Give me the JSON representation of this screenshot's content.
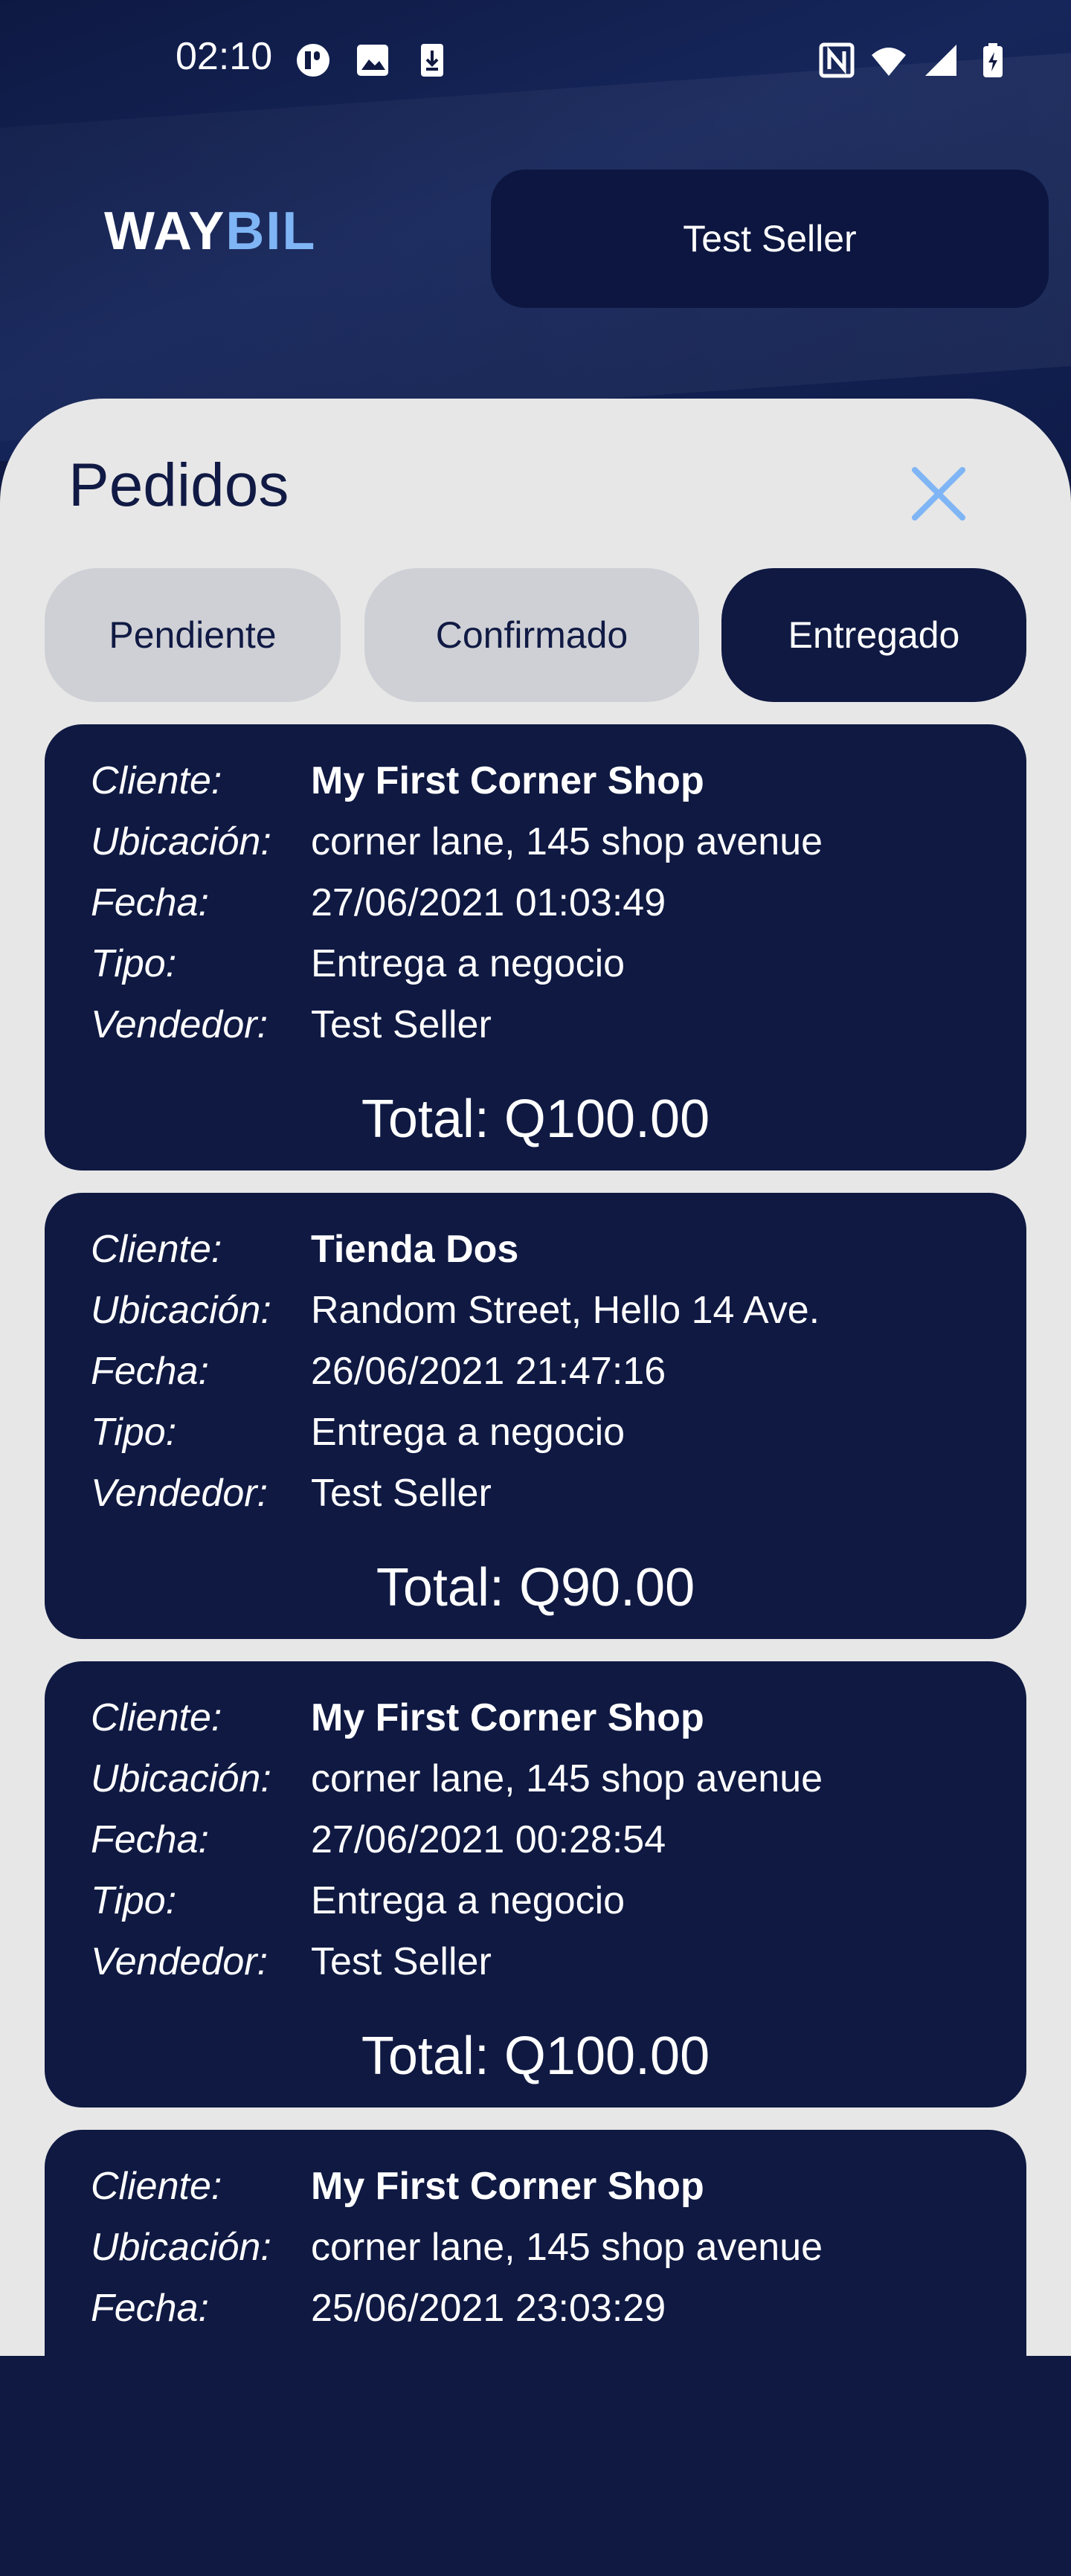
{
  "status_bar": {
    "time": "02:10",
    "icons": [
      "record-icon",
      "image-icon",
      "download-icon",
      "nfc-icon",
      "wifi-icon",
      "signal-icon",
      "battery-charging-icon"
    ]
  },
  "header": {
    "logo_part1": "WAY",
    "logo_part2": "BIL",
    "seller_button": "Test Seller"
  },
  "sheet": {
    "title": "Pedidos",
    "tabs": [
      {
        "label": "Pendiente",
        "active": false
      },
      {
        "label": "Confirmado",
        "active": false
      },
      {
        "label": "Entregado",
        "active": true
      }
    ]
  },
  "labels": {
    "cliente": "Cliente:",
    "ubicacion": "Ubicación:",
    "fecha": "Fecha:",
    "tipo": "Tipo:",
    "vendedor": "Vendedor:",
    "total": "Total:"
  },
  "orders": [
    {
      "cliente": "My First Corner Shop",
      "ubicacion": "corner lane, 145 shop avenue",
      "fecha": "27/06/2021 01:03:49",
      "tipo": "Entrega a negocio",
      "vendedor": "Test Seller",
      "total": "Q100.00"
    },
    {
      "cliente": "Tienda Dos",
      "ubicacion": "Random Street, Hello 14 Ave.",
      "fecha": "26/06/2021 21:47:16",
      "tipo": "Entrega a negocio",
      "vendedor": "Test Seller",
      "total": "Q90.00"
    },
    {
      "cliente": "My First Corner Shop",
      "ubicacion": "corner lane, 145 shop avenue",
      "fecha": "27/06/2021 00:28:54",
      "tipo": "Entrega a negocio",
      "vendedor": "Test Seller",
      "total": "Q100.00"
    },
    {
      "cliente": "My First Corner Shop",
      "ubicacion": "corner lane, 145 shop avenue",
      "fecha": "25/06/2021 23:03:29"
    }
  ],
  "colors": {
    "navy": "#0f1942",
    "accent": "#7fb5f5",
    "sheet": "#e7e7e7",
    "tab_inactive": "#cfd0d5"
  }
}
